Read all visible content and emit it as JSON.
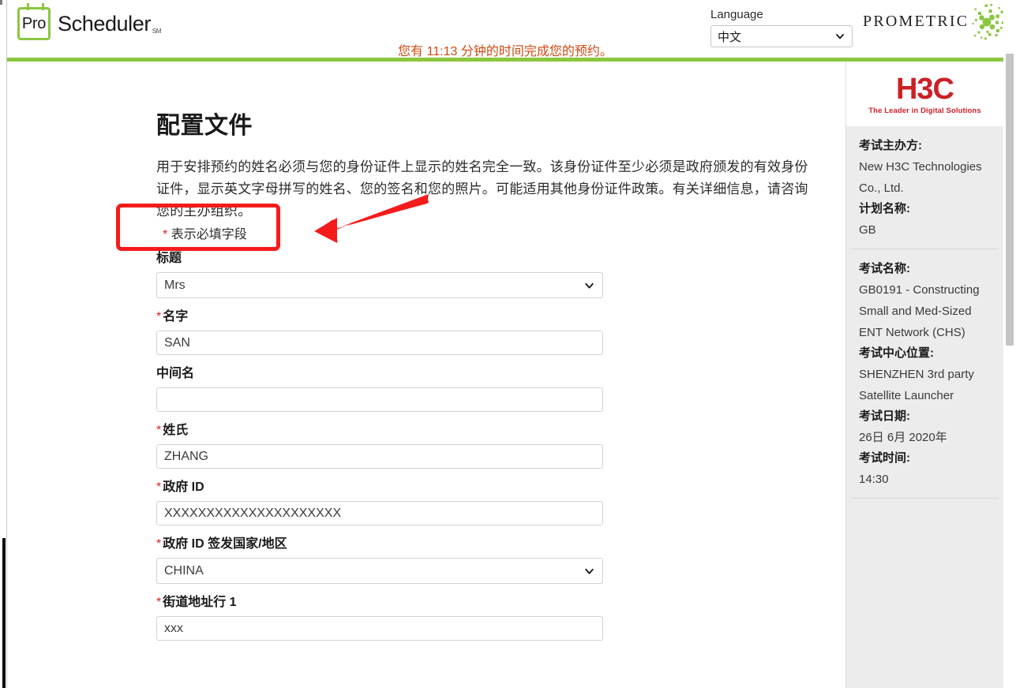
{
  "header": {
    "brand_badge": "Pro",
    "brand_word": "Scheduler",
    "brand_sm": "SM",
    "language_label": "Language",
    "language_value": "中文",
    "prometric_word": "PROMETRIC",
    "timer_text": "您有 11:13 分钟的时间完成您的预约。"
  },
  "main": {
    "title": "配置文件",
    "description": "用于安排预约的姓名必须与您的身份证件上显示的姓名完全一致。该身份证件至少必须是政府颁发的有效身份证件，显示英文字母拼写的姓名、您的签名和您的照片。可能适用其他身份证件政策。有关详细信息，请咨询您的主办组织。",
    "required_star": "*",
    "required_note": "表示必填字段",
    "fields": [
      {
        "label": "标题",
        "required": false,
        "type": "select",
        "value": "Mrs"
      },
      {
        "label": "名字",
        "required": true,
        "type": "text",
        "value": "SAN"
      },
      {
        "label": "中间名",
        "required": false,
        "type": "text",
        "value": ""
      },
      {
        "label": "姓氏",
        "required": true,
        "type": "text",
        "value": "ZHANG"
      },
      {
        "label": "政府 ID",
        "required": true,
        "type": "text",
        "value": "XXXXXXXXXXXXXXXXXXXXX"
      },
      {
        "label": "政府 ID 签发国家/地区",
        "required": true,
        "type": "select",
        "value": "CHINA"
      },
      {
        "label": "街道地址行 1",
        "required": true,
        "type": "text",
        "value": "xxx"
      }
    ]
  },
  "sidebar": {
    "logo_text": "H3C",
    "logo_tagline": "The Leader in Digital Solutions",
    "groups": [
      {
        "items": [
          {
            "label": "考试主办方:",
            "value": "New H3C Technologies Co., Ltd."
          },
          {
            "label": "计划名称:",
            "value": "GB"
          }
        ]
      },
      {
        "items": [
          {
            "label": "考试名称:",
            "value": "GB0191 - Constructing Small and Med-Sized ENT Network (CHS)"
          },
          {
            "label": "考试中心位置:",
            "value": "SHENZHEN 3rd party Satellite Launcher"
          },
          {
            "label": "考试日期:",
            "value": "26日 6月 2020年"
          },
          {
            "label": "考试时间:",
            "value": "14:30"
          }
        ]
      }
    ]
  },
  "colors": {
    "brand_green": "#8cc63f",
    "timer_orange": "#d04a10",
    "required_red": "#e02020",
    "annotation_red": "#f51b1b",
    "h3c_red": "#cc2026",
    "sidebar_bg": "#ececec"
  }
}
